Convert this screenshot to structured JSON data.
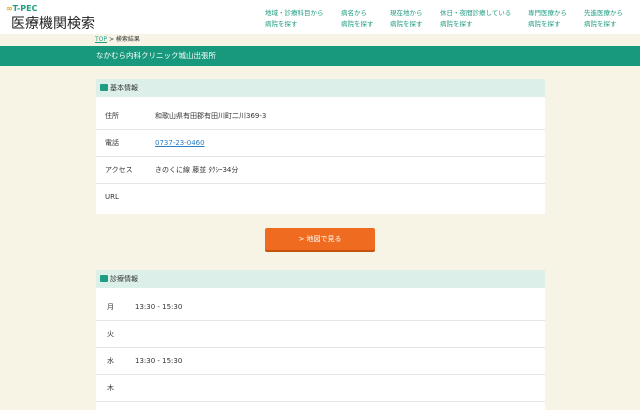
{
  "header": {
    "logo_sub": "T-PEC",
    "logo_main": "医療機関検索",
    "nav": [
      [
        "地域・診療科目から",
        "病院を探す"
      ],
      [
        "病名から",
        "病院を探す"
      ],
      [
        "現在地から",
        "病院を探す"
      ],
      [
        "休日・夜間診療している",
        "病院を探す"
      ],
      [
        "専門医療から",
        "病院を探す"
      ],
      [
        "先進医療から",
        "病院を探す"
      ]
    ]
  },
  "breadcrumb": {
    "top": "TOP",
    "sep": ">",
    "current": "検索結果"
  },
  "title": "なかむら内科クリニック城山出張所",
  "basic": {
    "heading": "基本情報",
    "rows": [
      {
        "k": "住所",
        "v": "和歌山県有田郡有田川町二川369-3"
      },
      {
        "k": "電話",
        "v": "0737-23-0460"
      },
      {
        "k": "アクセス",
        "v": "きのくに線 藤並 ﾀｸｼｰ34分"
      },
      {
        "k": "URL",
        "v": ""
      }
    ]
  },
  "map_button": "> 地図で見る",
  "schedule": {
    "heading": "診療情報",
    "rows": [
      {
        "k": "月",
        "v": "13:30 - 15:30"
      },
      {
        "k": "火",
        "v": ""
      },
      {
        "k": "水",
        "v": "13:30 - 15:30"
      },
      {
        "k": "木",
        "v": ""
      }
    ]
  }
}
